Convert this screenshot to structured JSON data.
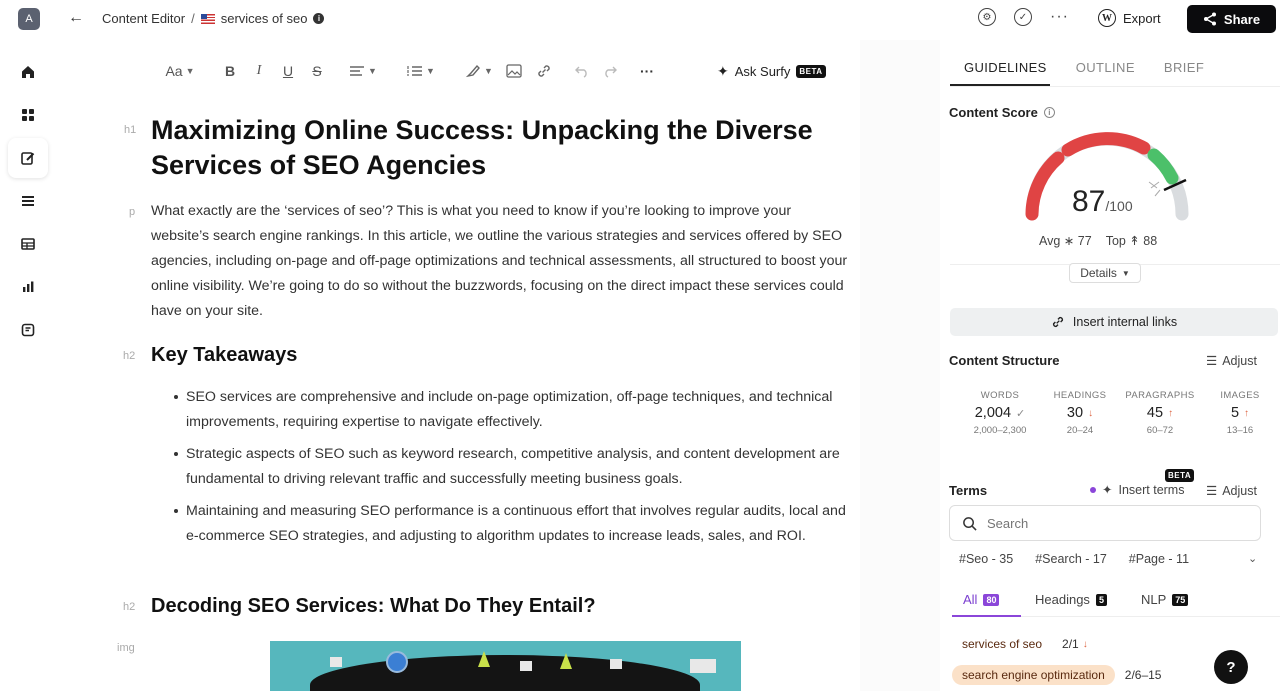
{
  "app": {
    "avatar_letter": "A",
    "breadcrumb_root": "Content Editor",
    "breadcrumb_sep": "/",
    "doc_title": "services of seo",
    "export_label": "Export",
    "share_label": "Share"
  },
  "toolbar": {
    "font_label": "Aa",
    "bold": "B",
    "italic": "I",
    "underline": "U",
    "strike": "S",
    "more": "···",
    "ask_label": "Ask Surfy",
    "beta": "BETA"
  },
  "editor": {
    "tag_h1": "h1",
    "tag_p": "p",
    "tag_h2": "h2",
    "tag_img": "img",
    "title": "Maximizing Online Success: Unpacking the Diverse Services of SEO Agencies",
    "intro": "What exactly are the ‘services of seo’? This is what you need to know if you’re looking to improve your website’s search engine rankings. In this article, we outline the various strategies and services offered by SEO agencies, including on-page and off-page optimizations and technical assessments, all structured to boost your online visibility. We’re going to do so without the buzzwords, focusing on the direct impact these services could have on your site.",
    "h2_takeaways": "Key Takeaways",
    "bullets": [
      "SEO services are comprehensive and include on-page optimization, off-page techniques, and technical improvements, requiring expertise to navigate effectively.",
      "Strategic aspects of SEO such as keyword research, competitive analysis, and content development are fundamental to driving relevant traffic and successfully meeting business goals.",
      "Maintaining and measuring SEO performance is a continuous effort that involves regular audits, local and e-commerce SEO strategies, and adjusting to algorithm updates to increase leads, sales, and ROI."
    ],
    "h2_decoding": "Decoding SEO Services: What Do They Entail?"
  },
  "panel": {
    "tabs": [
      "GUIDELINES",
      "OUTLINE",
      "BRIEF"
    ],
    "content_score_title": "Content Score",
    "score": "87",
    "score_of": "/100",
    "score_value": 87,
    "avg_label": "Avg",
    "avg_value": "77",
    "top_label": "Top",
    "top_value": "88",
    "details_label": "Details",
    "insert_links_label": "Insert internal links",
    "structure_title": "Content Structure",
    "adjust_label": "Adjust",
    "metrics": [
      {
        "label": "WORDS",
        "value": "2,004",
        "mark": "✓",
        "range": "2,000–2,300"
      },
      {
        "label": "HEADINGS",
        "value": "30",
        "mark": "↓",
        "range": "20–24"
      },
      {
        "label": "PARAGRAPHS",
        "value": "45",
        "mark": "↑",
        "range": "60–72"
      },
      {
        "label": "IMAGES",
        "value": "5",
        "mark": "↑",
        "range": "13–16"
      }
    ],
    "terms_title": "Terms",
    "insert_terms_label": "Insert terms",
    "terms_beta": "BETA",
    "search_placeholder": "Search",
    "chips": [
      "#Seo - 35",
      "#Search - 17",
      "#Page - 11"
    ],
    "sub_tabs": [
      {
        "label": "All",
        "count": "80"
      },
      {
        "label": "Headings",
        "count": "5"
      },
      {
        "label": "NLP",
        "count": "75"
      }
    ],
    "terms": [
      {
        "term": "services of seo",
        "count": "2/1",
        "mark": "↓"
      },
      {
        "term": "search engine optimization",
        "count": "2/6–15",
        "mark": ""
      }
    ]
  },
  "colors": {
    "accent_purple": "#8b46d9",
    "gauge_red": "#e04444",
    "gauge_green": "#4cc06a",
    "gauge_gray": "#d9dcdf"
  },
  "icons": [
    "home-icon",
    "grid-icon",
    "edit-icon",
    "list-icon",
    "table-icon",
    "bar-chart-icon",
    "doc-icon",
    "help-icon"
  ]
}
